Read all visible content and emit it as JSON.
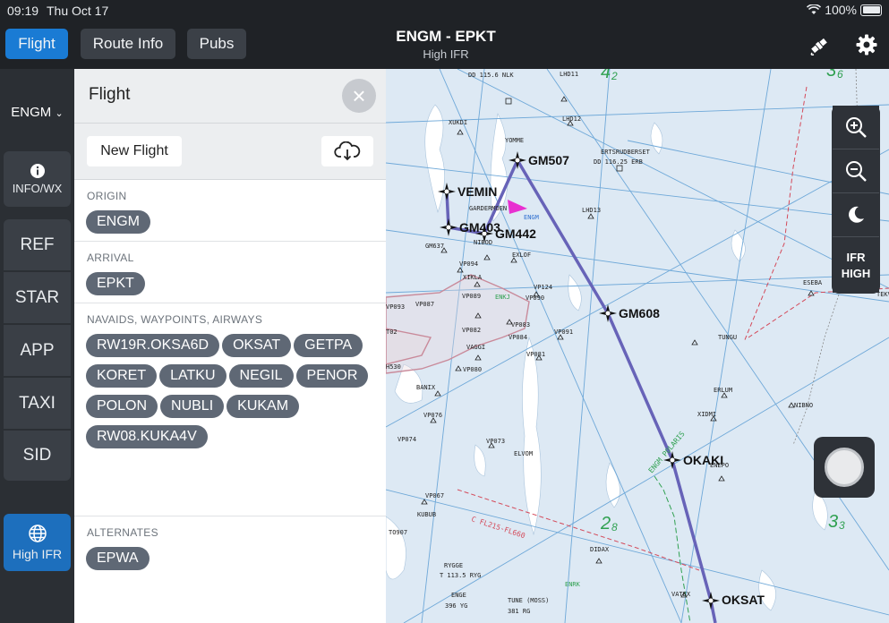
{
  "status_bar": {
    "time": "09:19",
    "date": "Thu Oct 17",
    "battery": "100%"
  },
  "toolbar": {
    "tabs": [
      {
        "label": "Flight",
        "active": true
      },
      {
        "label": "Route Info",
        "active": false
      },
      {
        "label": "Pubs",
        "active": false
      }
    ],
    "route_title": "ENGM - EPKT",
    "route_subtitle": "High IFR"
  },
  "left_nav": {
    "airport": "ENGM",
    "info_label": "INFO/WX",
    "items": [
      "REF",
      "STAR",
      "APP",
      "TAXI",
      "SID"
    ],
    "layer_label": "High IFR"
  },
  "panel": {
    "title": "Flight",
    "new_flight_label": "New Flight",
    "origin_label": "ORIGIN",
    "origin": "ENGM",
    "arrival_label": "ARRIVAL",
    "arrival": "EPKT",
    "route_label": "NAVAIDS, WAYPOINTS, AIRWAYS",
    "route_items": [
      "RW19R.OKSA6D",
      "OKSAT",
      "GETPA",
      "KORET",
      "LATKU",
      "NEGIL",
      "PENOR",
      "POLON",
      "NUBLI",
      "KUKAM",
      "RW08.KUKA4V"
    ],
    "alternates_label": "ALTERNATES",
    "alternates": [
      "EPWA"
    ]
  },
  "map": {
    "route_waypoints": [
      "VEMIN",
      "GM403",
      "GM442",
      "GM507",
      "GM608",
      "OKAKI",
      "OKSAT"
    ],
    "small_labels": [
      "DD 115.6 NLK",
      "LHD11",
      "XUKDI",
      "LHD12",
      "YOMME",
      "ERTSRUDBERSET",
      "DD 116.25 ERB",
      "GARDERMOEN",
      "LHD13",
      "ENGM",
      "GM637",
      "NIBOD",
      "EXLOF",
      "VP094",
      "XIKLA",
      "VP124",
      "VP093",
      "VP087",
      "VP089",
      "ENKJ",
      "VP090",
      "VP083",
      "T02",
      "VP082",
      "VP084",
      "VP091",
      "VAGGI",
      "VP081",
      "H530",
      "VP080",
      "BANIX",
      "VP076",
      "VP074",
      "VP073",
      "ELVOM",
      "VP067",
      "KUBUB",
      "TO907",
      "RYGGE",
      "T 113.5 RYG",
      "ENGE",
      "396 YG",
      "TUNE (MOSS)",
      "381 RG",
      "DIDAX",
      "ENRK",
      "VATEX",
      "TUNGU",
      "ESEBA",
      "ERLUM",
      "XIDMI",
      "NIBNO",
      "ENEPO",
      "C FL215-FL660",
      "TEKV",
      "ENGM POLARIS"
    ],
    "grid_numbers": [
      "4",
      "2",
      "3",
      "6",
      "2",
      "8",
      "3",
      "3"
    ],
    "controls": {
      "layer_line1": "IFR",
      "layer_line2": "HIGH"
    }
  },
  "colors": {
    "accent": "#1a7bd4",
    "route": "#6763b8",
    "chip": "#5f6875",
    "map_bg": "#dde9f4"
  }
}
